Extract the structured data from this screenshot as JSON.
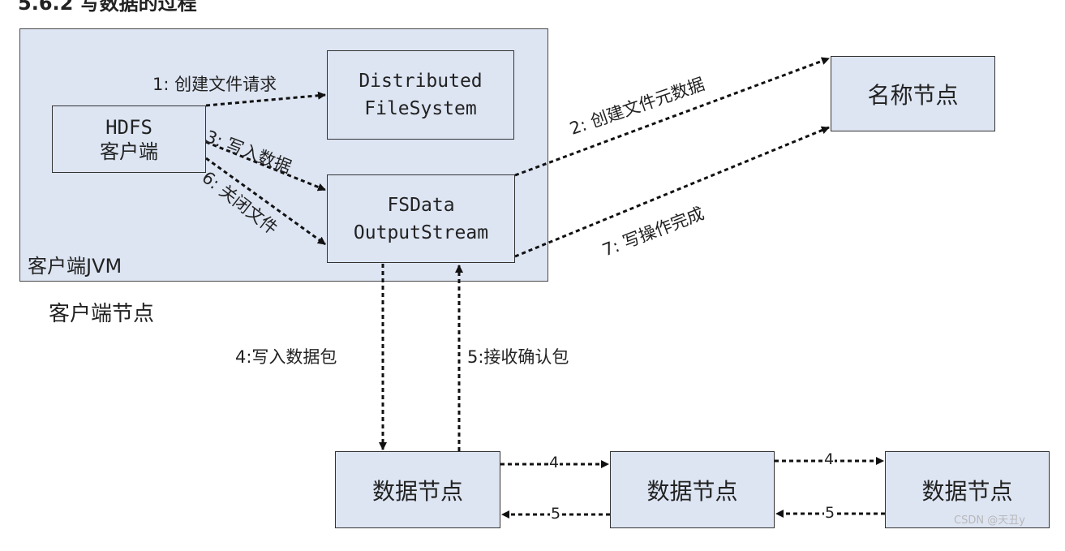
{
  "heading": "5.6.2 写数据的过程",
  "client_jvm_label": "客户端JVM",
  "client_node_label": "客户端节点",
  "hdfs_client": {
    "line1": "HDFS",
    "line2": "客户端"
  },
  "distributed_fs": {
    "line1": "Distributed",
    "line2": "FileSystem"
  },
  "fsdata": {
    "line1": "FSData",
    "line2": "OutputStream"
  },
  "namenode": "名称节点",
  "datanodes": [
    "数据节点",
    "数据节点",
    "数据节点"
  ],
  "steps": {
    "s1": "1: 创建文件请求",
    "s2": "2: 创建文件元数据",
    "s3": "3: 写入数据",
    "s4": "4:写入数据包",
    "s5": "5:接收确认包",
    "s6": "6: 关闭文件",
    "s7": "7: 写操作完成",
    "dn4a": "4",
    "dn4b": "4",
    "dn5a": "5",
    "dn5b": "5"
  },
  "watermark": "CSDN @天丑y"
}
